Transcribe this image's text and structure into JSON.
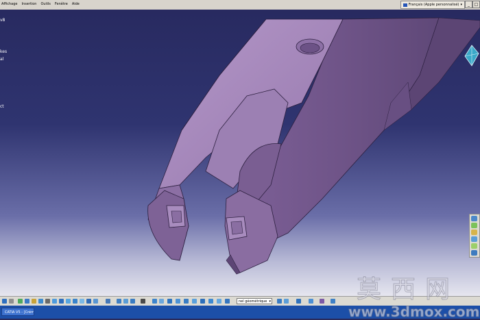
{
  "menubar": {
    "items": [
      "Affichage",
      "Insertion",
      "Outils",
      "Fenêtre",
      "Aide"
    ],
    "ime_label": "Français (Apple personnalisé)",
    "window_buttons": [
      "_",
      "□"
    ]
  },
  "tree": {
    "rows": [
      {
        "text": "v8"
      },
      {
        "text": "kes"
      },
      {
        "text": "al"
      },
      {
        "text": "ct"
      }
    ]
  },
  "toolbar": {
    "render_style_value": "nel géométrique 10"
  },
  "taskbar": {
    "app_button": "CATIA V5 - [Crémaux_..."
  },
  "watermark": {
    "chinese": "莫西网",
    "url": "www.3dmox.com"
  },
  "colors": {
    "part_face_light": "#9d80b4",
    "part_face_mid": "#8a6da1",
    "part_face_dark": "#6b5285",
    "background_top": "#282a60",
    "background_bottom": "#e6e6ef"
  }
}
